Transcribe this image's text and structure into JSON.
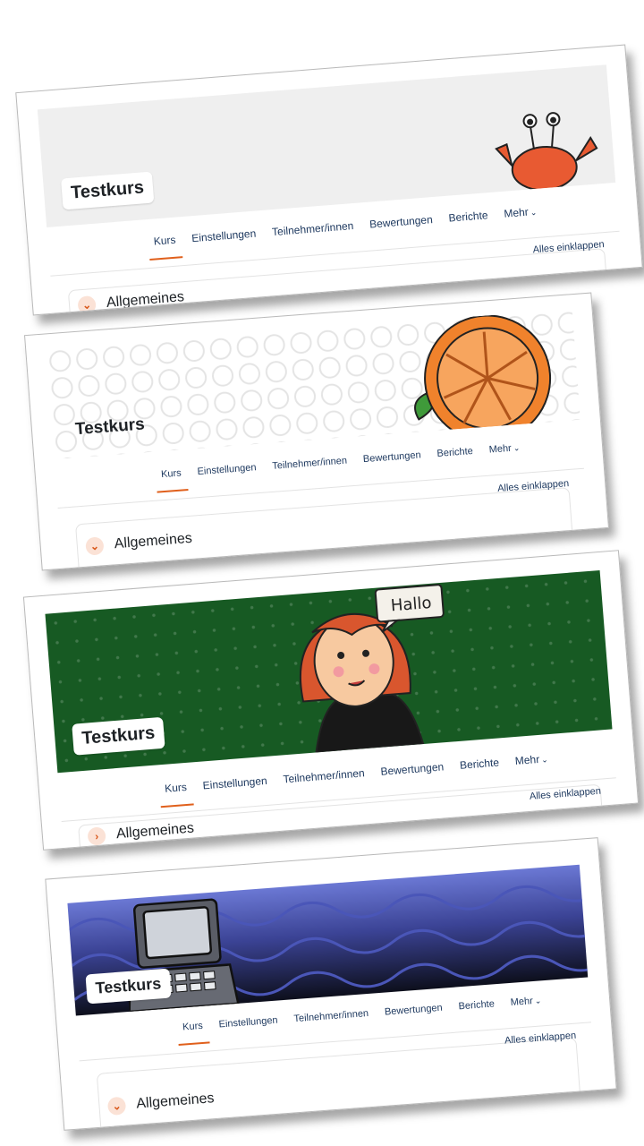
{
  "cards": [
    {
      "title": "Testkurs",
      "tabs": [
        "Kurs",
        "Einstellungen",
        "Teilnehmer/innen",
        "Bewertungen",
        "Berichte",
        "Mehr"
      ],
      "collapse_all": "Alles einklappen",
      "section_title": "Allgemeines",
      "section_icon": "chevron-down-icon",
      "banner": "crab"
    },
    {
      "title": "Testkurs",
      "tabs": [
        "Kurs",
        "Einstellungen",
        "Teilnehmer/innen",
        "Bewertungen",
        "Berichte",
        "Mehr"
      ],
      "collapse_all": "Alles einklappen",
      "section_title": "Allgemeines",
      "section_icon": "chevron-down-icon",
      "banner": "orange"
    },
    {
      "title": "Testkurs",
      "tabs": [
        "Kurs",
        "Einstellungen",
        "Teilnehmer/innen",
        "Bewertungen",
        "Berichte",
        "Mehr"
      ],
      "collapse_all": "Alles einklappen",
      "section_title": "Allgemeines",
      "section_icon": "chevron-right-icon",
      "banner": "hallo",
      "speech": "Hallo"
    },
    {
      "title": "Testkurs",
      "tabs": [
        "Kurs",
        "Einstellungen",
        "Teilnehmer/innen",
        "Bewertungen",
        "Berichte",
        "Mehr"
      ],
      "collapse_all": "Alles einklappen",
      "section_title": "Allgemeines",
      "section_icon": "chevron-down-icon",
      "banner": "laptop"
    }
  ],
  "colors": {
    "accent": "#e0601c",
    "link": "#1f3a60",
    "green_banner": "#175a23"
  }
}
